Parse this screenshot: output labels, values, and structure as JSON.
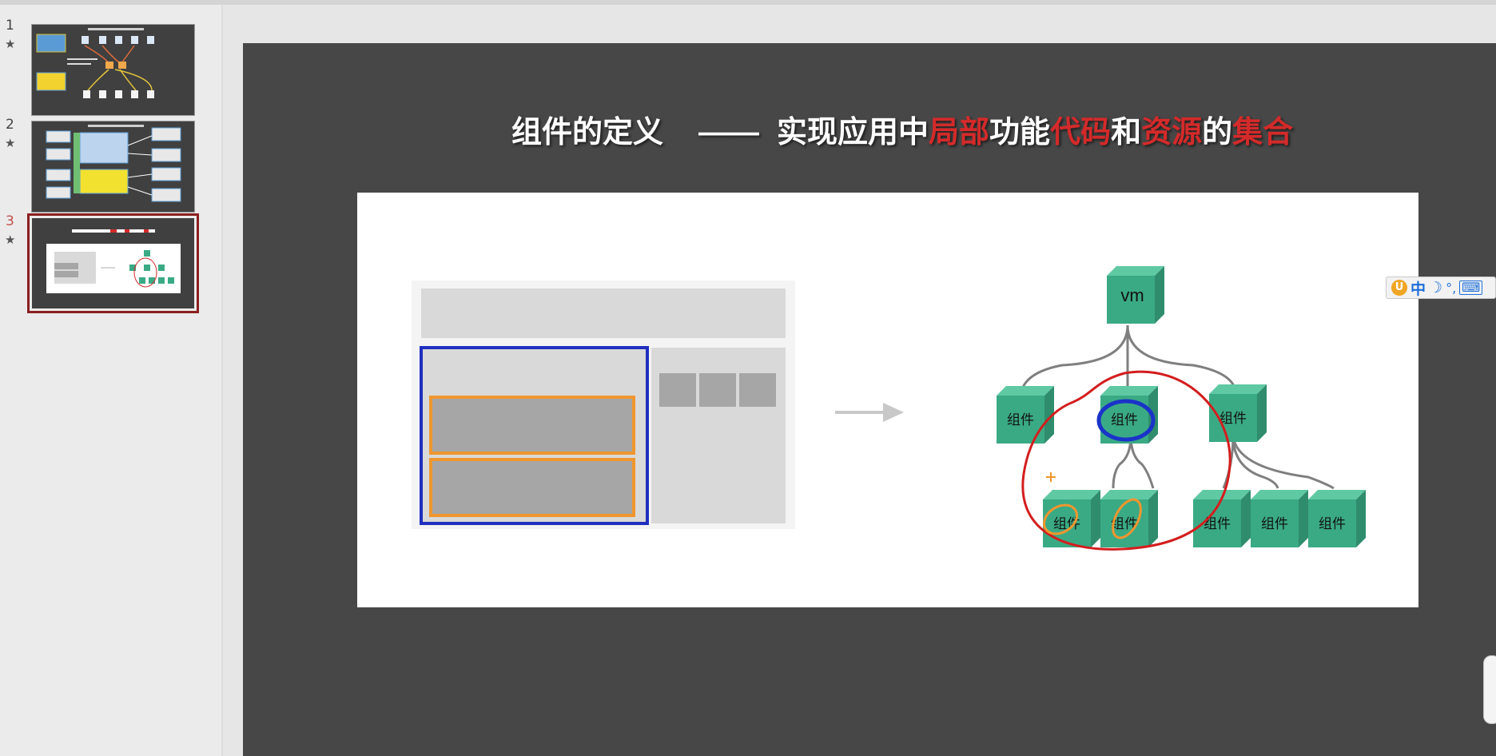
{
  "thumbnails": [
    {
      "number": "1",
      "star": "★",
      "active": false
    },
    {
      "number": "2",
      "star": "★",
      "active": false
    },
    {
      "number": "3",
      "star": "★",
      "active": true
    }
  ],
  "slide": {
    "title_parts": [
      {
        "text": "组件的定义",
        "red": false
      },
      {
        "text": "——",
        "red": false
      },
      {
        "text": "实现应用中",
        "red": false
      },
      {
        "text": "局部",
        "red": true
      },
      {
        "text": "功能",
        "red": false
      },
      {
        "text": "代码",
        "red": true
      },
      {
        "text": "和",
        "red": false
      },
      {
        "text": "资源",
        "red": true
      },
      {
        "text": "的",
        "red": false
      },
      {
        "text": "集合",
        "red": true
      }
    ],
    "root_label": "vm",
    "node_label": "组件",
    "colors": {
      "background": "#474747",
      "highlight_red": "#d42a2a",
      "node_green": "#3aaa85",
      "outline_blue": "#1f2fbf",
      "outline_orange": "#f0962e"
    }
  },
  "ime_toolbar": {
    "lang": "中",
    "moon": "☽",
    "punct": "°,",
    "keyboard": "⌨"
  }
}
